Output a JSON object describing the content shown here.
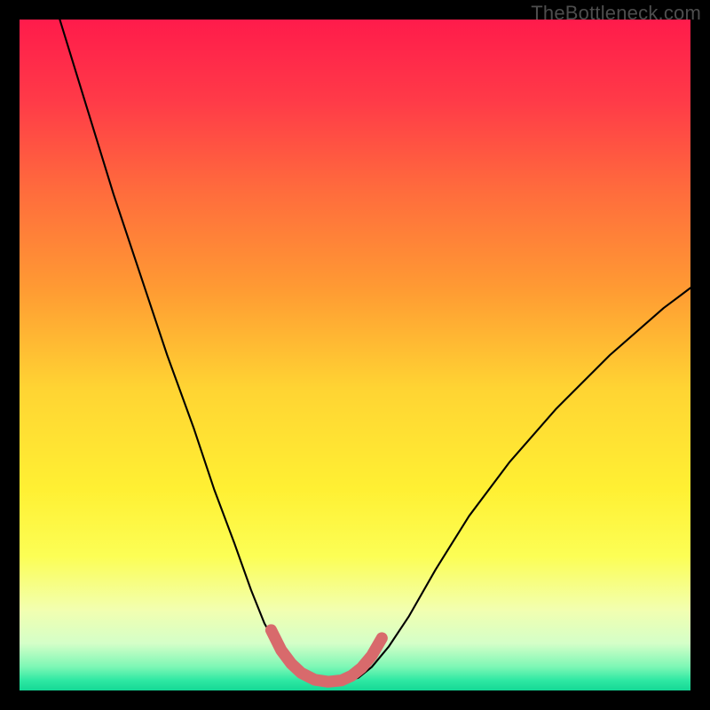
{
  "watermark": "TheBottleneck.com",
  "colors": {
    "frame": "#000000",
    "curve_stroke": "#000000",
    "highlight_stroke": "#d86a6c",
    "gradient_stops": [
      {
        "offset": 0.0,
        "color": "#ff1b4b"
      },
      {
        "offset": 0.12,
        "color": "#ff3a48"
      },
      {
        "offset": 0.25,
        "color": "#ff6a3d"
      },
      {
        "offset": 0.4,
        "color": "#ff9a33"
      },
      {
        "offset": 0.55,
        "color": "#ffd433"
      },
      {
        "offset": 0.7,
        "color": "#fff033"
      },
      {
        "offset": 0.8,
        "color": "#fcfe55"
      },
      {
        "offset": 0.88,
        "color": "#f2ffb0"
      },
      {
        "offset": 0.93,
        "color": "#d4ffc8"
      },
      {
        "offset": 0.965,
        "color": "#7cf7b5"
      },
      {
        "offset": 0.985,
        "color": "#2ee8a3"
      },
      {
        "offset": 1.0,
        "color": "#15d895"
      }
    ]
  },
  "chart_data": {
    "type": "line",
    "title": "",
    "xlabel": "",
    "ylabel": "",
    "xlim": [
      0,
      100
    ],
    "ylim": [
      0,
      100
    ],
    "note": "Axes are unlabeled in the source image; x/y are normalized 0–100. y=0 is the bottom (green) edge, y=100 is the top (red) edge.",
    "series": [
      {
        "name": "left-branch",
        "x": [
          6,
          10,
          14,
          18,
          22,
          26,
          29,
          32,
          34.5,
          36.5,
          38.5,
          40,
          41.5,
          43
        ],
        "y": [
          100,
          87,
          74,
          62,
          50,
          39,
          30,
          22,
          15,
          10,
          6.5,
          4,
          2.5,
          1.8
        ]
      },
      {
        "name": "valley-floor",
        "x": [
          43,
          45,
          47,
          49,
          50.5
        ],
        "y": [
          1.8,
          1.3,
          1.2,
          1.4,
          1.9
        ]
      },
      {
        "name": "right-branch",
        "x": [
          50.5,
          52.5,
          55,
          58,
          62,
          67,
          73,
          80,
          88,
          96,
          100
        ],
        "y": [
          1.9,
          3.5,
          6.5,
          11,
          18,
          26,
          34,
          42,
          50,
          57,
          60
        ]
      }
    ],
    "highlight": {
      "name": "valley-highlight",
      "description": "Thick rounded pinkish overlay marking the low-bottleneck region near the curve minimum.",
      "x": [
        37.5,
        39,
        40.5,
        42,
        44,
        46,
        48,
        49.5,
        51,
        52.5,
        54
      ],
      "y": [
        9,
        6,
        4,
        2.6,
        1.6,
        1.3,
        1.5,
        2.2,
        3.4,
        5.2,
        7.8
      ]
    }
  }
}
